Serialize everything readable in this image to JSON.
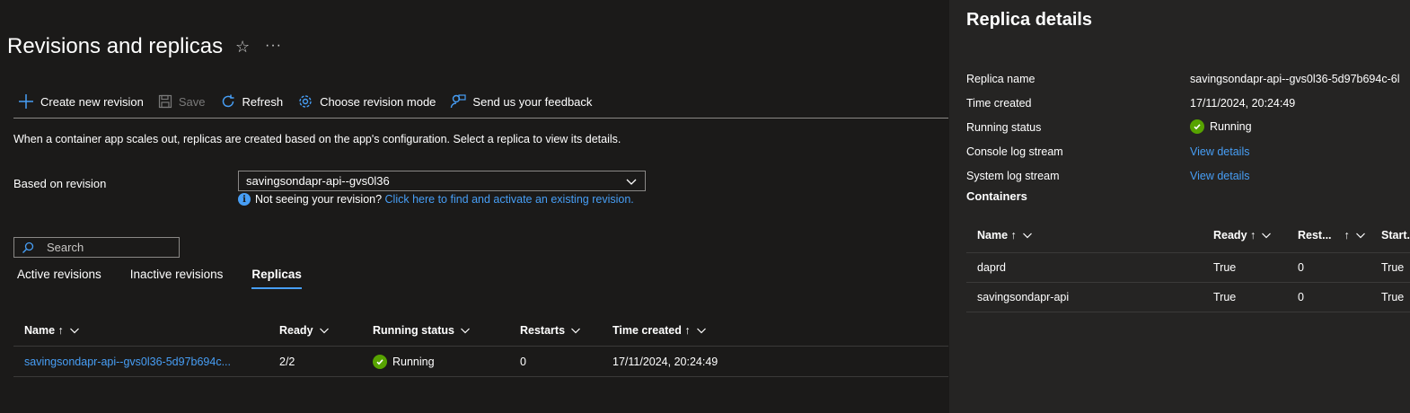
{
  "page": {
    "title": "Revisions and replicas",
    "favorite_icon": "star-icon",
    "more_icon": "more-icon"
  },
  "toolbar": {
    "create_label": "Create new revision",
    "save_label": "Save",
    "refresh_label": "Refresh",
    "mode_label": "Choose revision mode",
    "feedback_label": "Send us your feedback"
  },
  "description": "When a container app scales out, replicas are created based on the app's configuration. Select a replica to view its details.",
  "revision_select": {
    "label": "Based on revision",
    "value": "savingsondapr-api--gvs0l36",
    "hint_text": "Not seeing your revision?",
    "hint_link": "Click here to find and activate an existing revision."
  },
  "search": {
    "placeholder": "Search"
  },
  "tabs": [
    {
      "label": "Active revisions",
      "active": false
    },
    {
      "label": "Inactive revisions",
      "active": false
    },
    {
      "label": "Replicas",
      "active": true
    }
  ],
  "replicas_table": {
    "headers": {
      "name": "Name ↑",
      "ready": "Ready",
      "status": "Running status",
      "restarts": "Restarts",
      "time": "Time created ↑"
    },
    "rows": [
      {
        "name": "savingsondapr-api--gvs0l36-5d97b694c...",
        "ready": "2/2",
        "status": "Running",
        "restarts": "0",
        "time": "17/11/2024, 20:24:49"
      }
    ]
  },
  "details": {
    "title": "Replica details",
    "replica_name_label": "Replica name",
    "replica_name": "savingsondapr-api--gvs0l36-5d97b694c-6l",
    "time_created_label": "Time created",
    "time_created": "17/11/2024, 20:24:49",
    "running_status_label": "Running status",
    "running_status": "Running",
    "console_log_label": "Console log stream",
    "console_log_link": "View details",
    "system_log_label": "System log stream",
    "system_log_link": "View details",
    "containers_title": "Containers",
    "containers_headers": {
      "name": "Name ↑",
      "ready": "Ready ↑",
      "restarts": "Rest...",
      "start": "Start..."
    },
    "containers": [
      {
        "name": "daprd",
        "ready": "True",
        "restarts": "0",
        "start": "True"
      },
      {
        "name": "savingsondapr-api",
        "ready": "True",
        "restarts": "0",
        "start": "True"
      }
    ]
  },
  "colors": {
    "background": "#1b1a19",
    "panel": "#252423",
    "accent": "#479ef5",
    "success": "#57a300"
  }
}
